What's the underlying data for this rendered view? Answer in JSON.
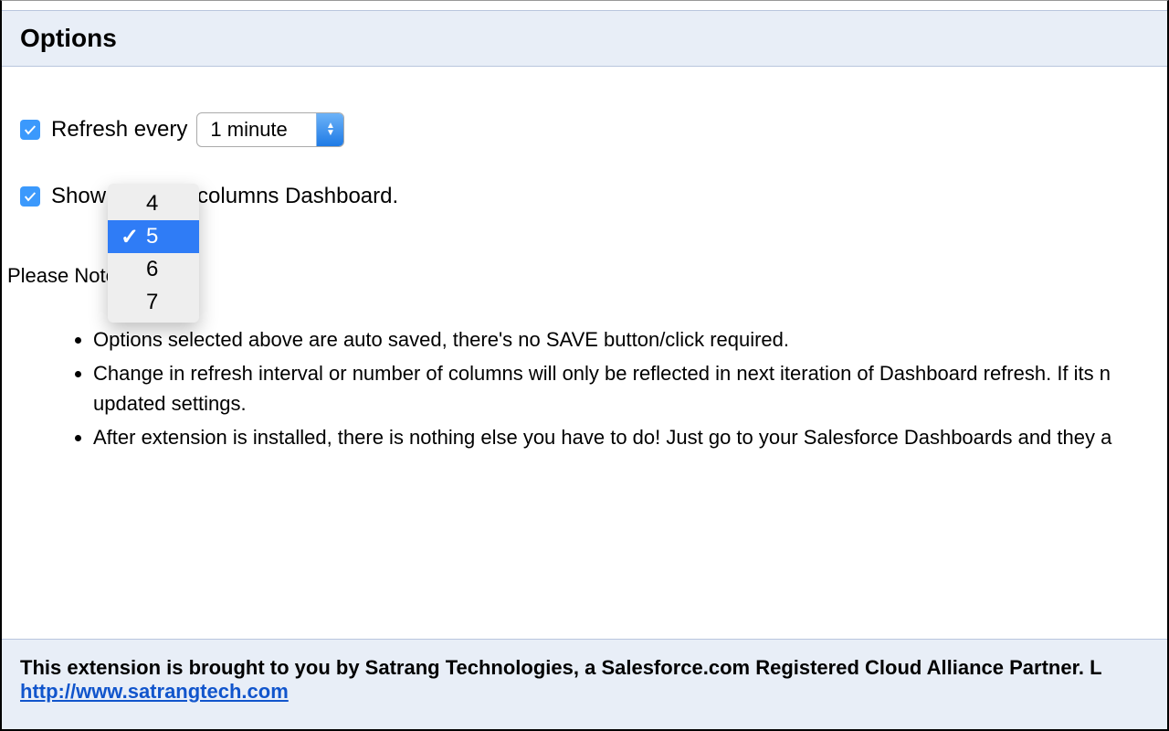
{
  "header": {
    "title": "Options"
  },
  "options": {
    "refresh_label_pre": "Refresh every",
    "refresh_value": "1 minute",
    "show_label_pre": "Show",
    "show_label_post": " columns Dashboard."
  },
  "dropdown": {
    "items": [
      "4",
      "5",
      "6",
      "7"
    ],
    "selected": "5"
  },
  "notes": {
    "heading": "Please Note:",
    "items": [
      "Options selected above are auto saved, there's no SAVE button/click required.",
      "Change in refresh interval or number of columns will only be reflected in next iteration of Dashboard refresh. If its n updated settings.",
      "After extension is installed, there is nothing else you have to do! Just go to your Salesforce Dashboards and they a"
    ]
  },
  "footer": {
    "text": "This extension is brought to you by Satrang Technologies, a Salesforce.com Registered Cloud Alliance Partner. L",
    "link": "http://www.satrangtech.com"
  }
}
